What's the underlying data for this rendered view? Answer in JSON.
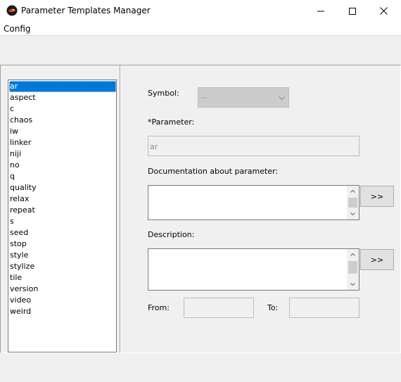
{
  "window": {
    "title": "Parameter Templates Manager",
    "icon": "app-logo-icon",
    "controls": [
      "minimize-icon",
      "maximize-icon",
      "close-icon"
    ]
  },
  "menu": {
    "items": [
      "Config"
    ]
  },
  "parameters": {
    "items": [
      "ar",
      "aspect",
      "c",
      "chaos",
      "iw",
      "linker",
      "niji",
      "no",
      "q",
      "quality",
      "relax",
      "repeat",
      "s",
      "seed",
      "stop",
      "style",
      "stylize",
      "tile",
      "version",
      "video",
      "weird"
    ],
    "selected": "ar"
  },
  "form": {
    "symbol_label": "Symbol:",
    "symbol_value": "--",
    "parameter_label": "*Parameter:",
    "parameter_value": "ar",
    "doc_label": "Documentation about parameter:",
    "doc_value": "",
    "desc_label": "Description:",
    "desc_value": "",
    "expand_label": ">>",
    "from_label": "From:",
    "to_label": "To:"
  },
  "colors": {
    "selection": "#0078d7",
    "window_bg": "#f0f0f0",
    "titlebar_bg": "#ffffff"
  }
}
